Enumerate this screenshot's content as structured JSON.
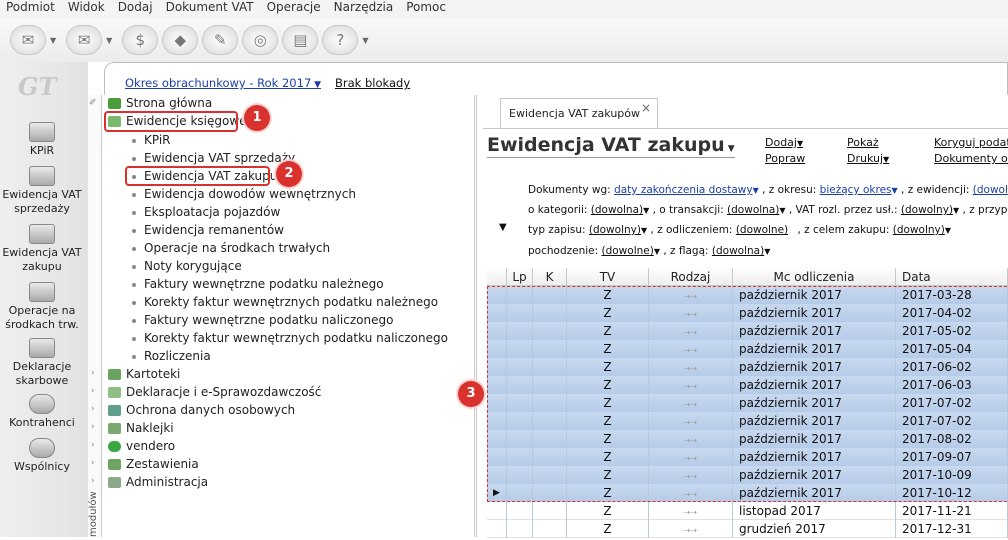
{
  "menu": [
    "Podmiot",
    "Widok",
    "Dodaj",
    "Dokument VAT",
    "Operacje",
    "Narzędzia",
    "Pomoc"
  ],
  "logo": "GT",
  "nav": [
    {
      "label": "KPiR"
    },
    {
      "label": "Ewidencja VAT sprzedaży"
    },
    {
      "label": "Ewidencja VAT zakupu"
    },
    {
      "label": "Operacje na środkach trw."
    },
    {
      "label": "Deklaracje skarbowe"
    },
    {
      "label": "Kontrahenci"
    },
    {
      "label": "Wspólnicy"
    }
  ],
  "modules_vertical": "modułów",
  "top": {
    "okres": "Okres obrachunkowy - Rok 2017",
    "brak": "Brak blokady"
  },
  "tree": [
    {
      "label": "Strona główna"
    },
    {
      "label": "Ewidencje księgowe"
    },
    {
      "label": "KPiR"
    },
    {
      "label": "Ewidencja VAT sprzedaży"
    },
    {
      "label": "Ewidencja VAT zakupu"
    },
    {
      "label": "Ewidencja dowodów wewnętrznych"
    },
    {
      "label": "Eksploatacja pojazdów"
    },
    {
      "label": "Ewidencja remanentów"
    },
    {
      "label": "Operacje na środkach trwałych"
    },
    {
      "label": "Noty korygujące"
    },
    {
      "label": "Faktury wewnętrzne podatku należnego"
    },
    {
      "label": "Korekty faktur wewnętrznych podatku należnego"
    },
    {
      "label": "Faktury wewnętrzne podatku naliczonego"
    },
    {
      "label": "Korekty faktur wewnętrznych podatku naliczonego"
    },
    {
      "label": "Rozliczenia"
    },
    {
      "label": "Kartoteki"
    },
    {
      "label": "Deklaracje i e-Sprawozdawczość"
    },
    {
      "label": "Ochrona danych osobowych"
    },
    {
      "label": "Naklejki"
    },
    {
      "label": "vendero"
    },
    {
      "label": "Zestawienia"
    },
    {
      "label": "Administracja"
    }
  ],
  "badges": [
    "1",
    "2",
    "3"
  ],
  "tab": {
    "label": "Ewidencja VAT zakupów",
    "close": "×"
  },
  "title": "Ewidencja VAT zakupu",
  "actions": {
    "dodaj": "Dodaj",
    "popraw": "Popraw",
    "pokaz": "Pokaż",
    "drukuj": "Drukuj",
    "koryguj": "Koryguj podatek",
    "dokumenty": "Dokumenty odli"
  },
  "filters": {
    "l1a": "Dokumenty wg:",
    "l1b": "daty zakończenia dostawy",
    "l1c": ", z okresu:",
    "l1d": "bieżący okres",
    "l1e": ", z ewidencji:",
    "l1f": "(dowol",
    "l2a": "o kategorii:",
    "l2b": "(dowolna)",
    "l2c": ", o transakcji:",
    "l2d": "(dowolna)",
    "l2e": ", VAT rozl. przez usł.:",
    "l2f": "(dowolny)",
    "l2g": ", z przyp",
    "l3a": "typ zapisu:",
    "l3b": "(dowolny)",
    "l3c": ", z odliczeniem:",
    "l3d": "(dowolne)",
    "l3e": ", z celem zakupu:",
    "l3f": "(dowolny)",
    "l4a": "pochodzenie:",
    "l4b": "(dowolne)",
    "l4c": ", z flagą:",
    "l4d": "(dowolna)"
  },
  "columns": [
    "Lp",
    "K",
    "TV",
    "Rodzaj",
    "Mc odliczenia",
    "Data otrzymani"
  ],
  "rows": [
    {
      "tv": "Z",
      "mc": "październik 2017",
      "data": "2017-03-28",
      "sel": true
    },
    {
      "tv": "Z",
      "mc": "październik 2017",
      "data": "2017-04-02",
      "sel": true
    },
    {
      "tv": "Z",
      "mc": "październik 2017",
      "data": "2017-05-02",
      "sel": true
    },
    {
      "tv": "Z",
      "mc": "październik 2017",
      "data": "2017-05-04",
      "sel": true
    },
    {
      "tv": "Z",
      "mc": "październik 2017",
      "data": "2017-06-02",
      "sel": true
    },
    {
      "tv": "Z",
      "mc": "październik 2017",
      "data": "2017-06-03",
      "sel": true
    },
    {
      "tv": "Z",
      "mc": "październik 2017",
      "data": "2017-07-02",
      "sel": true
    },
    {
      "tv": "Z",
      "mc": "październik 2017",
      "data": "2017-07-02",
      "sel": true
    },
    {
      "tv": "Z",
      "mc": "październik 2017",
      "data": "2017-08-02",
      "sel": true
    },
    {
      "tv": "Z",
      "mc": "październik 2017",
      "data": "2017-09-07",
      "sel": true
    },
    {
      "tv": "Z",
      "mc": "październik 2017",
      "data": "2017-10-09",
      "sel": true
    },
    {
      "tv": "Z",
      "mc": "październik 2017",
      "data": "2017-10-12",
      "sel": true
    },
    {
      "tv": "Z",
      "mc": "listopad 2017",
      "data": "2017-11-21",
      "sel": false
    },
    {
      "tv": "Z",
      "mc": "grudzień 2017",
      "data": "2017-12-31",
      "sel": false
    }
  ],
  "colors": {
    "accent": "#d9322e",
    "link": "#1a3fa6",
    "selection": "#c3d6ee"
  }
}
